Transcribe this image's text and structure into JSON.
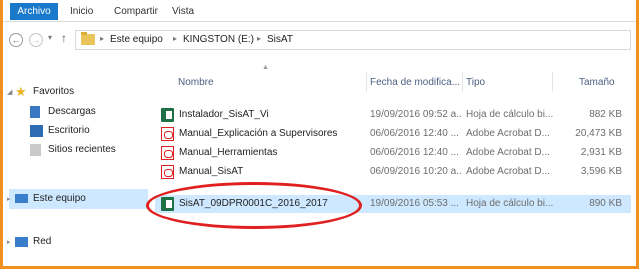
{
  "ribbon": {
    "tabs": [
      "Archivo",
      "Inicio",
      "Compartir",
      "Vista"
    ]
  },
  "address": {
    "crumbs": [
      "Este equipo",
      "KINGSTON (E:)",
      "SisAT"
    ]
  },
  "nav_pane": {
    "favorites_label": "Favoritos",
    "favorites_items": [
      "Descargas",
      "Escritorio",
      "Sitios recientes"
    ],
    "this_pc_label": "Este equipo",
    "network_label": "Red"
  },
  "columns": {
    "name": "Nombre",
    "date": "Fecha de modifica...",
    "type": "Tipo",
    "size": "Tamaño"
  },
  "files": [
    {
      "name": "Instalador_SisAT_Vi",
      "date": "19/09/2016 09:52 a...",
      "type": "Hoja de cálculo bi...",
      "size": "882 KB",
      "icon": "excel-file-icon"
    },
    {
      "name": "Manual_Explicación a Supervisores",
      "date": "06/06/2016 12:40 ...",
      "type": "Adobe Acrobat D...",
      "size": "20,473 KB",
      "icon": "pdf-file-icon"
    },
    {
      "name": "Manual_Herramientas",
      "date": "06/06/2016 12:40 ...",
      "type": "Adobe Acrobat D...",
      "size": "2,931 KB",
      "icon": "pdf-file-icon"
    },
    {
      "name": "Manual_SisAT",
      "date": "06/09/2016 10:20 a...",
      "type": "Adobe Acrobat D...",
      "size": "3,596 KB",
      "icon": "pdf-file-icon"
    },
    {
      "name": "SisAT_09DPR0001C_2016_2017",
      "date": "19/09/2016 05:53 ...",
      "type": "Hoja de cálculo bi...",
      "size": "890 KB",
      "icon": "excel-file-icon",
      "selected": true
    }
  ],
  "colors": {
    "frame": "#f0901e",
    "highlight_ellipse": "#e02020",
    "selection": "#cde8ff",
    "archivo_tab": "#1979ca"
  }
}
